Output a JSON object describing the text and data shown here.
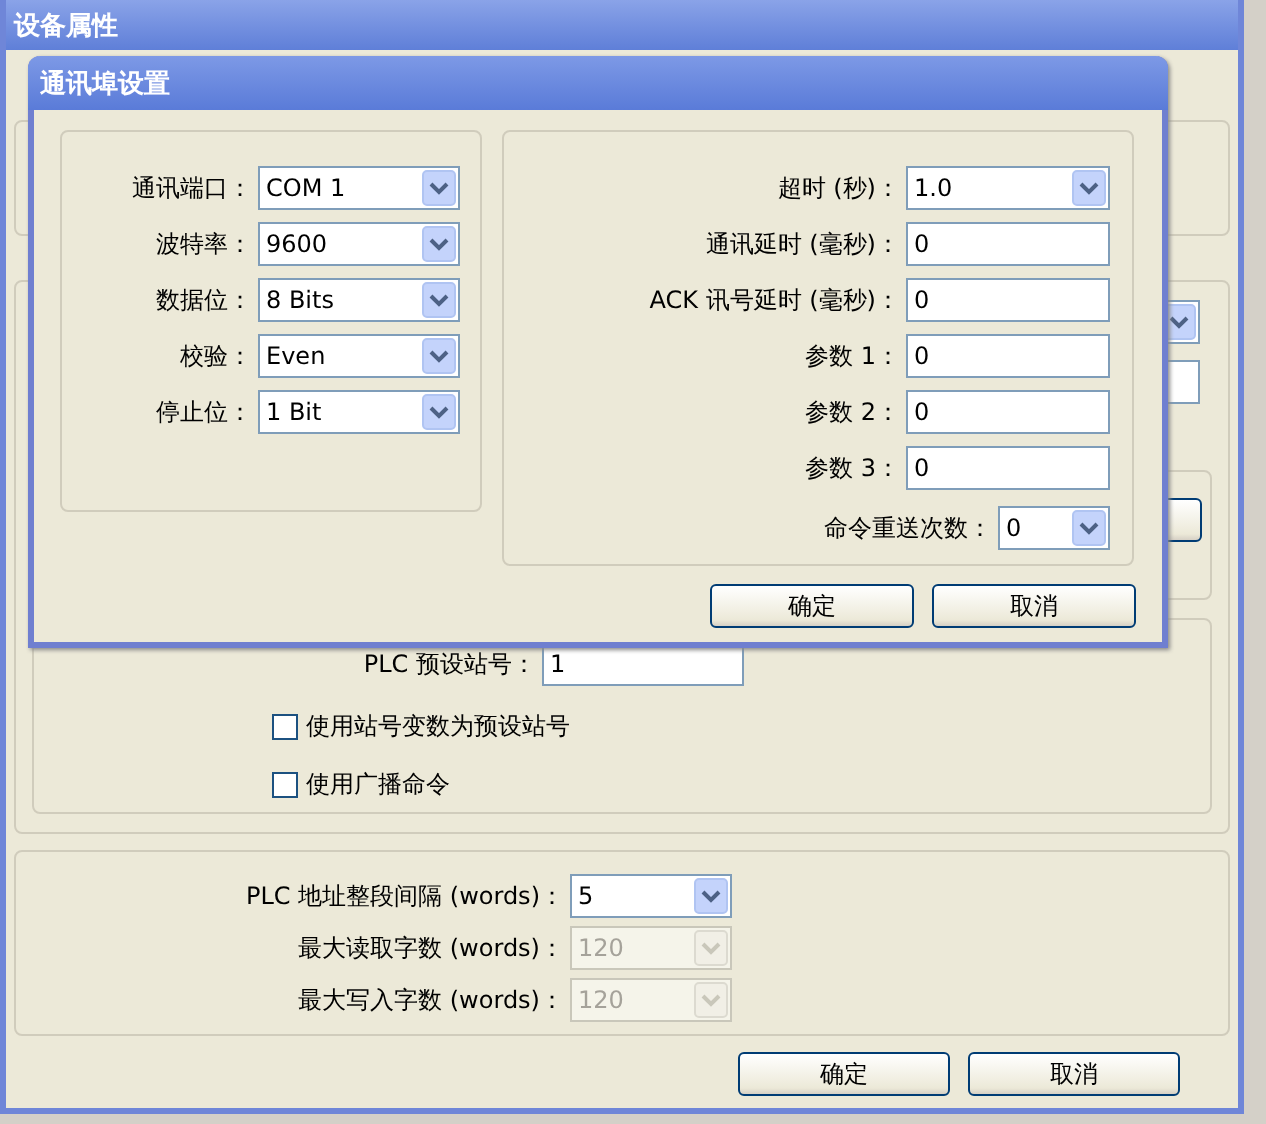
{
  "window": {
    "title": "设备属性"
  },
  "station": {
    "label": "PLC 预设站号：",
    "value": "1"
  },
  "checkboxes": [
    {
      "label": "使用站号变数为预设站号",
      "checked": false
    },
    {
      "label": "使用广播命令",
      "checked": false
    }
  ],
  "address_rows": [
    {
      "label": "PLC 地址整段间隔 (words)：",
      "value": "5",
      "disabled": false
    },
    {
      "label": "最大读取字数 (words)：",
      "value": "120",
      "disabled": true
    },
    {
      "label": "最大写入字数 (words)：",
      "value": "120",
      "disabled": true
    }
  ],
  "buttons": [
    "确定",
    "取消"
  ],
  "dialog": {
    "title": "通讯埠设置",
    "left_fields": [
      {
        "label": "通讯端口：",
        "value": "COM 1",
        "kind": "dropdown"
      },
      {
        "label": "波特率：",
        "value": "9600",
        "kind": "dropdown"
      },
      {
        "label": "数据位：",
        "value": "8 Bits",
        "kind": "dropdown"
      },
      {
        "label": "校验：",
        "value": "Even",
        "kind": "dropdown"
      },
      {
        "label": "停止位：",
        "value": "1 Bit",
        "kind": "dropdown"
      }
    ],
    "right_fields": [
      {
        "label": "超时 (秒)：",
        "value": "1.0",
        "kind": "dropdown"
      },
      {
        "label": "通讯延时 (毫秒)：",
        "value": "0",
        "kind": "text"
      },
      {
        "label": "ACK 讯号延时 (毫秒)：",
        "value": "0",
        "kind": "text"
      },
      {
        "label": "参数 1：",
        "value": "0",
        "kind": "text"
      },
      {
        "label": "参数 2：",
        "value": "0",
        "kind": "text"
      },
      {
        "label": "参数 3：",
        "value": "0",
        "kind": "text"
      },
      {
        "label": "命令重送次数：",
        "value": "0",
        "kind": "small-dropdown"
      }
    ],
    "buttons": [
      "确定",
      "取消"
    ]
  }
}
